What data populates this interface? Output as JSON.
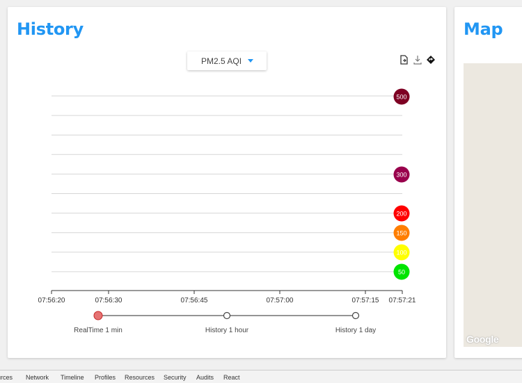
{
  "history": {
    "title": "History",
    "select": {
      "value": "PM2.5 AQI"
    },
    "toolbar": {
      "icons": [
        "export-icon",
        "download-icon",
        "diamond-nav-icon"
      ]
    }
  },
  "map": {
    "title": "Map",
    "attribution": "Google"
  },
  "chart_data": {
    "type": "scatter",
    "x_ticks": [
      "07:56:20",
      "07:56:30",
      "07:56:45",
      "07:57:00",
      "07:57:15",
      "07:57:21"
    ],
    "aqi_levels": [
      {
        "value": 500,
        "color": "#7e0023"
      },
      {
        "value": 300,
        "color": "#99004c"
      },
      {
        "value": 200,
        "color": "#ff0000"
      },
      {
        "value": 150,
        "color": "#ff7e00"
      },
      {
        "value": 100,
        "color": "#ffff00"
      },
      {
        "value": 50,
        "color": "#00e400"
      }
    ],
    "grid": true
  },
  "timeline": {
    "items": [
      {
        "label": "RealTime 1 min",
        "active": true
      },
      {
        "label": "History 1 hour",
        "active": false
      },
      {
        "label": "History 1 day",
        "active": false
      }
    ]
  },
  "devtools": {
    "tabs": [
      "urces",
      "Network",
      "Timeline",
      "Profiles",
      "Resources",
      "Security",
      "Audits",
      "React"
    ]
  }
}
